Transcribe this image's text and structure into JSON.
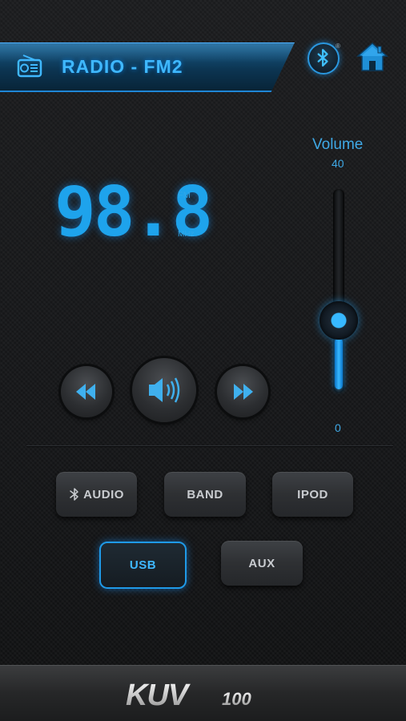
{
  "header": {
    "title": "RADIO - FM2",
    "radio_icon": "radio-icon",
    "bluetooth_icon": "bluetooth-icon",
    "bluetooth_reg": "®",
    "home_icon": "home-icon"
  },
  "tuner": {
    "frequency": "98.8",
    "band": "FM",
    "unit": "MHz"
  },
  "volume": {
    "label": "Volume",
    "max": "40",
    "min": "0",
    "level_fraction": 0.36
  },
  "controls": {
    "rewind_icon": "rewind-icon",
    "speaker_icon": "speaker-icon",
    "fast_forward_icon": "fast-forward-icon"
  },
  "sources": [
    {
      "label": "AUDIO",
      "icon": "bluetooth-icon",
      "active": false
    },
    {
      "label": "BAND",
      "active": false
    },
    {
      "label": "IPOD",
      "active": false
    },
    {
      "label": "USB",
      "active": true
    },
    {
      "label": "AUX",
      "active": false
    }
  ],
  "footer": {
    "logo_text": "KUV100"
  },
  "colors": {
    "accent": "#1ea3ec",
    "active_border": "#1f9ae8",
    "button_bg": "#2e3033",
    "background": "#141517"
  }
}
